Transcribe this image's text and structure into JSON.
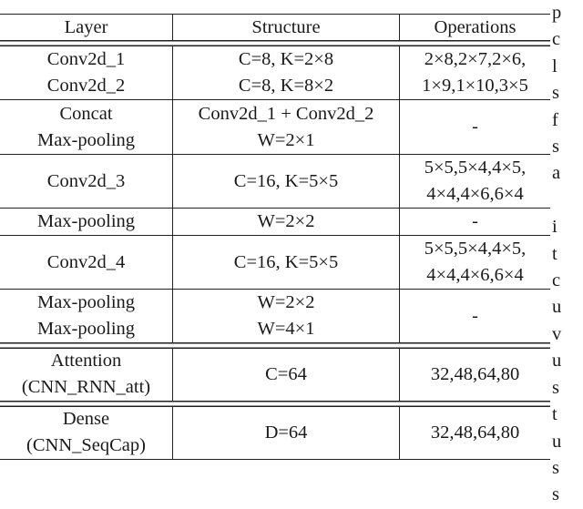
{
  "table": {
    "headers": [
      "Layer",
      "Structure",
      "Operations"
    ],
    "rows": [
      {
        "layer": [
          "Conv2d_1",
          "Conv2d_2"
        ],
        "structure": [
          "C=8, K=2×8",
          "C=8, K=8×2"
        ],
        "operations": [
          "2×8,2×7,2×6,",
          "1×9,1×10,3×5"
        ]
      },
      {
        "layer": [
          "Concat",
          "Max-pooling"
        ],
        "structure": [
          "Conv2d_1 + Conv2d_2",
          "W=2×1"
        ],
        "operations": [
          "-"
        ]
      },
      {
        "layer": [
          "Conv2d_3"
        ],
        "structure": [
          "C=16, K=5×5"
        ],
        "operations": [
          "5×5,5×4,4×5,",
          "4×4,4×6,6×4"
        ]
      },
      {
        "layer": [
          "Max-pooling"
        ],
        "structure": [
          "W=2×2"
        ],
        "operations": [
          "-"
        ]
      },
      {
        "layer": [
          "Conv2d_4"
        ],
        "structure": [
          "C=16, K=5×5"
        ],
        "operations": [
          "5×5,5×4,4×5,",
          "4×4,4×6,6×4"
        ]
      },
      {
        "layer": [
          "Max-pooling",
          "Max-pooling"
        ],
        "structure": [
          "W=2×2",
          "W=4×1"
        ],
        "operations": [
          "-"
        ]
      },
      {
        "layer": [
          "Attention",
          "(CNN_RNN_att)"
        ],
        "structure": [
          "C=64"
        ],
        "operations": [
          "32,48,64,80"
        ]
      },
      {
        "layer": [
          "Dense",
          "(CNN_SeqCap)"
        ],
        "structure": [
          "D=64"
        ],
        "operations": [
          "32,48,64,80"
        ]
      }
    ]
  },
  "side_text": [
    "p",
    "c",
    "l",
    "s",
    "f",
    "s",
    "a",
    "",
    "i",
    "t",
    "c",
    "u",
    "v",
    "u",
    "s",
    "t",
    "u",
    "s",
    "s"
  ]
}
